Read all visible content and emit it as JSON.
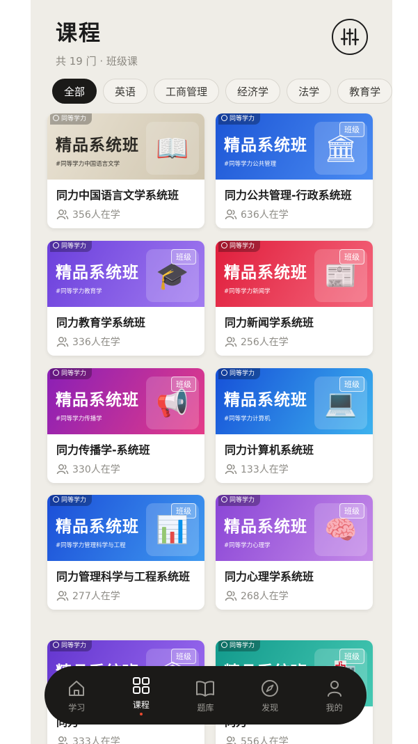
{
  "header": {
    "title": "课程",
    "subtitle": "共 19 门 · 班级课"
  },
  "chips": [
    "全部",
    "英语",
    "工商管理",
    "经济学",
    "法学",
    "教育学"
  ],
  "common": {
    "badge": "同等学力",
    "banner_title": "精品系统班",
    "class_tag": "班级"
  },
  "courses": [
    {
      "name": "同力中国语言文学系统班",
      "learners": "356人在学",
      "tag": "#同等学力中国语言文学",
      "color_a": "#e9e2d3",
      "color_b": "#cfc5ae",
      "icon": "book-icon"
    },
    {
      "name": "同力公共管理-行政系统班",
      "learners": "636人在学",
      "tag": "#同等学力公共管理",
      "color_a": "#1d56d6",
      "color_b": "#4a8cf2",
      "icon": "building-icon"
    },
    {
      "name": "同力教育学系统班",
      "learners": "336人在学",
      "tag": "#同等学力教育学",
      "color_a": "#6b3fdc",
      "color_b": "#a27cf0",
      "icon": "graduation-cap-icon"
    },
    {
      "name": "同力新闻学系统班",
      "learners": "256人在学",
      "tag": "#同等学力新闻学",
      "color_a": "#e01e3c",
      "color_b": "#f4667c",
      "icon": "news-icon"
    },
    {
      "name": "同力传播学-系统班",
      "learners": "330人在学",
      "tag": "#同等学力传播学",
      "color_a": "#8a1fb6",
      "color_b": "#e43c88",
      "icon": "megaphone-icon"
    },
    {
      "name": "同力计算机系统班",
      "learners": "133人在学",
      "tag": "#同等学力计算机",
      "color_a": "#1650d8",
      "color_b": "#3db2ee",
      "icon": "computer-icon"
    },
    {
      "name": "同力管理科学与工程系统班",
      "learners": "277人在学",
      "tag": "#同等学力管理科学与工程",
      "color_a": "#1b4ed8",
      "color_b": "#3f9af0",
      "icon": "chart-icon"
    },
    {
      "name": "同力心理学系统班",
      "learners": "268人在学",
      "tag": "#同等学力心理学",
      "color_a": "#8a45d6",
      "color_b": "#c58ae8",
      "icon": "brain-icon"
    },
    {
      "name": "同力",
      "learners": "333人在学",
      "tag": "",
      "color_a": "#6436cf",
      "color_b": "#9b6cf0",
      "icon": "building-icon"
    },
    {
      "name": "同力",
      "learners": "556人在学",
      "tag": "",
      "color_a": "#129a8c",
      "color_b": "#46c9b3",
      "icon": "hospital-icon"
    }
  ],
  "nav": [
    {
      "label": "学习",
      "icon": "home-icon"
    },
    {
      "label": "课程",
      "icon": "grid-icon"
    },
    {
      "label": "题库",
      "icon": "open-book-icon"
    },
    {
      "label": "发现",
      "icon": "compass-icon"
    },
    {
      "label": "我的",
      "icon": "person-icon"
    }
  ]
}
